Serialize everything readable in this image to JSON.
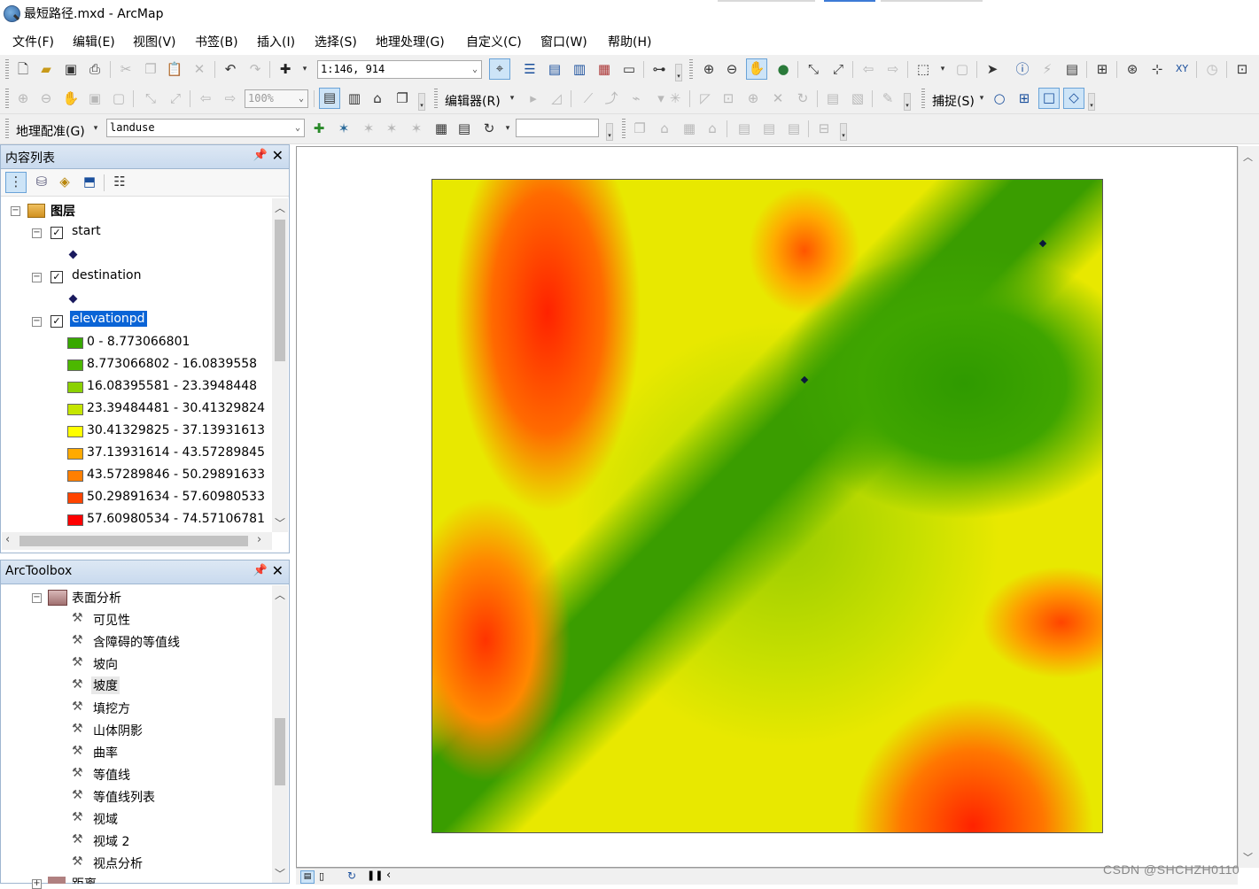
{
  "window": {
    "title": "最短路径.mxd - ArcMap"
  },
  "menu": [
    "文件(F)",
    "编辑(E)",
    "视图(V)",
    "书签(B)",
    "插入(I)",
    "选择(S)",
    "地理处理(G)",
    "自定义(C)",
    "窗口(W)",
    "帮助(H)"
  ],
  "toolbar1": {
    "scale_value": "1:146, 914"
  },
  "toolbar2": {
    "zoom_value": "100%",
    "editor_label": "编辑器(R)",
    "snapping_label": "捕捉(S)"
  },
  "toolbar3": {
    "georef_label": "地理配准(G)",
    "layer_value": "landuse"
  },
  "toc": {
    "title": "内容列表",
    "root_label": "图层",
    "layers": [
      {
        "name": "start"
      },
      {
        "name": "destination"
      },
      {
        "name": "elevationpd"
      }
    ],
    "classes": [
      {
        "label": "0 - 8.773066801",
        "color": "#38a800"
      },
      {
        "label": "8.773066802 - 16.0839558",
        "color": "#4cb800"
      },
      {
        "label": "16.08395581 - 23.3948448",
        "color": "#8bd100"
      },
      {
        "label": "23.39484481 - 30.41329824",
        "color": "#c5e600"
      },
      {
        "label": "30.41329825 - 37.13931613",
        "color": "#ffff00"
      },
      {
        "label": "37.13931614 - 43.57289845",
        "color": "#ffaa00"
      },
      {
        "label": "43.57289846 - 50.29891633",
        "color": "#ff7f00"
      },
      {
        "label": "50.29891634 - 57.60980533",
        "color": "#ff4400"
      },
      {
        "label": "57.60980534 - 74.57106781",
        "color": "#ff0000"
      }
    ]
  },
  "toolbox": {
    "title": "ArcToolbox",
    "group_label": "表面分析",
    "tools": [
      "可见性",
      "含障碍的等值线",
      "坡向",
      "坡度",
      "填挖方",
      "山体阴影",
      "曲率",
      "等值线",
      "等值线列表",
      "视域",
      "视域 2",
      "视点分析"
    ],
    "next_group_label": "距离"
  },
  "watermark": "CSDN @SHCHZH0110"
}
